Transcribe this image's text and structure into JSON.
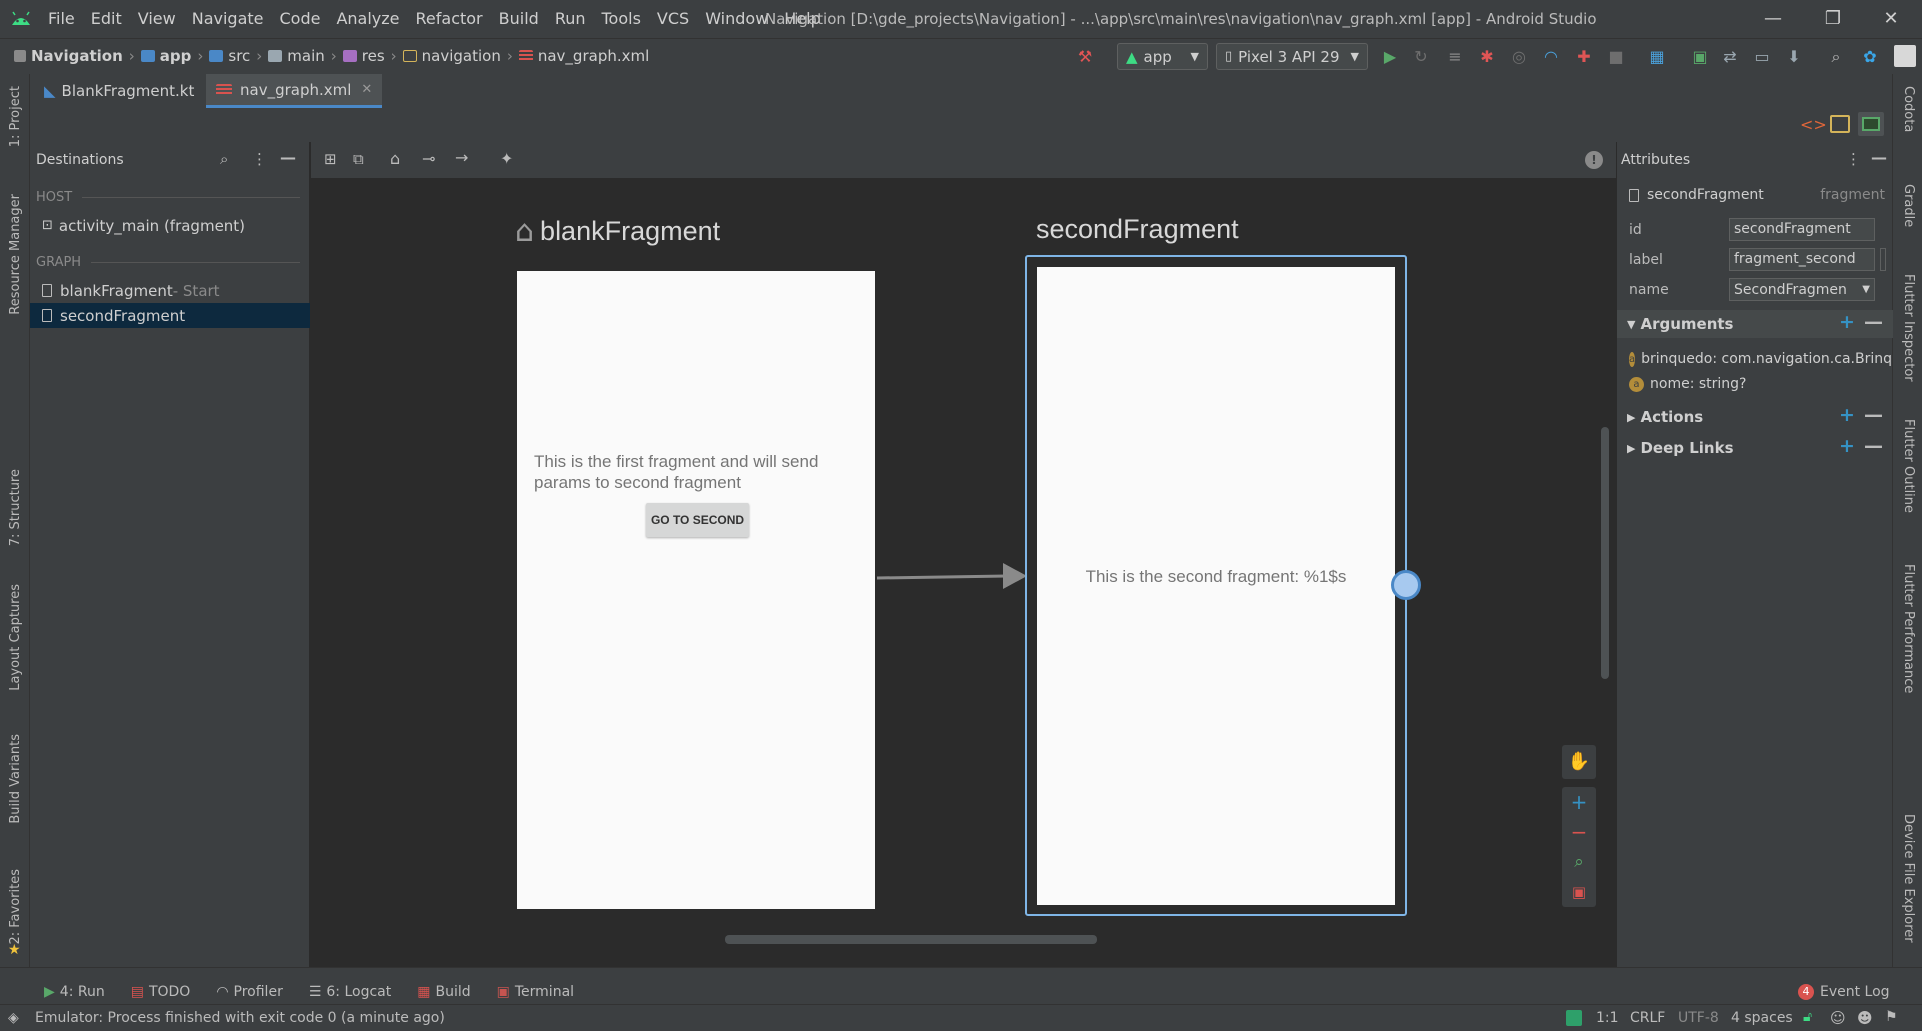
{
  "window": {
    "title": "Navigation [D:\\gde_projects\\Navigation] - ...\\app\\src\\main\\res\\navigation\\nav_graph.xml [app] - Android Studio",
    "menu": [
      "File",
      "Edit",
      "View",
      "Navigate",
      "Code",
      "Analyze",
      "Refactor",
      "Build",
      "Run",
      "Tools",
      "VCS",
      "Window",
      "Help"
    ],
    "controls": {
      "minimize": "—",
      "restore": "❐",
      "close": "✕"
    }
  },
  "breadcrumb": [
    "Navigation",
    "app",
    "src",
    "main",
    "res",
    "navigation",
    "nav_graph.xml"
  ],
  "toolbar": {
    "run_config": "app",
    "device": "Pixel 3 API 29"
  },
  "tabs": [
    {
      "label": "BlankFragment.kt",
      "active": false
    },
    {
      "label": "nav_graph.xml",
      "active": true
    }
  ],
  "left_strip": [
    "1: Project",
    "Resource Manager",
    "7: Structure",
    "Layout Captures",
    "Build Variants",
    "2: Favorites"
  ],
  "right_strip": [
    "Codota",
    "Gradle",
    "Flutter Inspector",
    "Flutter Outline",
    "Flutter Performance",
    "Device File Explorer"
  ],
  "destinations": {
    "title": "Destinations",
    "host_label": "HOST",
    "host_item": "activity_main (fragment)",
    "graph_label": "GRAPH",
    "items": [
      {
        "name": "blankFragment",
        "suffix": " - Start",
        "selected": false
      },
      {
        "name": "secondFragment",
        "suffix": "",
        "selected": true
      }
    ]
  },
  "canvas": {
    "fragment1": {
      "title": "blankFragment",
      "text": "This is the first fragment and will send params to second fragment",
      "button": "GO TO SECOND"
    },
    "fragment2": {
      "title": "secondFragment",
      "text": "This is the second fragment: %1$s"
    }
  },
  "attributes": {
    "title": "Attributes",
    "selected_name": "secondFragment",
    "selected_type": "fragment",
    "fields": [
      {
        "label": "id",
        "value": "secondFragment"
      },
      {
        "label": "label",
        "value": "fragment_second"
      },
      {
        "label": "name",
        "value": "SecondFragmen"
      }
    ],
    "arguments_label": "Arguments",
    "arguments": [
      "brinquedo: com.navigation.ca.Brinque",
      "nome: string?"
    ],
    "actions_label": "Actions",
    "deeplinks_label": "Deep Links"
  },
  "tool_windows": [
    "4: Run",
    "TODO",
    "Profiler",
    "6: Logcat",
    "Build",
    "Terminal"
  ],
  "event_log": {
    "count": "4",
    "label": "Event Log"
  },
  "status": {
    "message": "Emulator: Process finished with exit code 0 (a minute ago)",
    "position": "1:1",
    "line_sep": "CRLF",
    "encoding": "UTF-8",
    "indent": "4 spaces"
  },
  "colors": {
    "accent": "#4a88c7",
    "selection": "#0d293e",
    "background": "#2b2b2b",
    "panel": "#3c3f41"
  }
}
